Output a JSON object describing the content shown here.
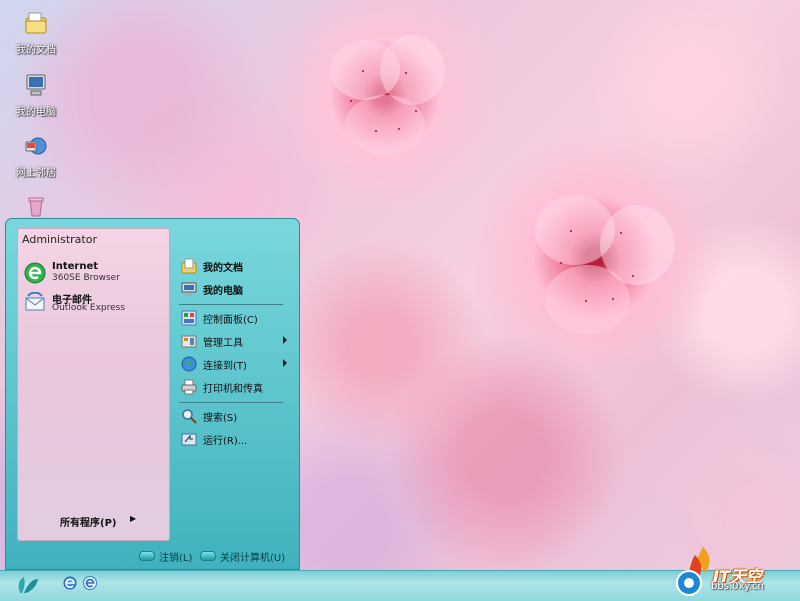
{
  "desktop": {
    "icons": [
      {
        "label": "我的文档",
        "icon": "documents-folder-icon"
      },
      {
        "label": "我的电脑",
        "icon": "computer-icon"
      },
      {
        "label": "网上邻居",
        "icon": "network-icon"
      },
      {
        "label": "",
        "icon": "recycle-bin-icon"
      }
    ]
  },
  "start_menu": {
    "user_name": "Administrator",
    "pinned": [
      {
        "title": "Internet",
        "subtitle": "360SE Browser",
        "icon": "browser-icon"
      },
      {
        "title": "电子邮件",
        "subtitle": "Outlook Express",
        "icon": "email-icon"
      }
    ],
    "all_programs": "所有程序(P)",
    "right_items": [
      {
        "label": "我的文档",
        "icon": "documents-folder-icon",
        "bold": true
      },
      {
        "label": "我的电脑",
        "icon": "computer-icon",
        "bold": true
      },
      {
        "label": "控制面板(C)",
        "icon": "control-panel-icon"
      },
      {
        "label": "管理工具",
        "icon": "admin-tools-icon",
        "submenu": true
      },
      {
        "label": "连接到(T)",
        "icon": "connect-globe-icon",
        "submenu": true
      },
      {
        "label": "打印机和传真",
        "icon": "printer-icon"
      },
      {
        "label": "搜索(S)",
        "icon": "search-icon"
      },
      {
        "label": "运行(R)...",
        "icon": "run-icon"
      }
    ],
    "logoff": "注销(L)",
    "shutdown": "关闭计算机(U)"
  },
  "taskbar": {
    "start_icon": "start-leaf-icon",
    "quick_launch": [
      "ie-icon",
      "browser-360-icon"
    ]
  },
  "watermark": {
    "title": "IT天空",
    "url": "bbs.0xy.cn"
  },
  "colors": {
    "accent": "#4fb9c3",
    "taskbar": "#8fd8de",
    "menu_left_pane": "#f3cde0"
  }
}
